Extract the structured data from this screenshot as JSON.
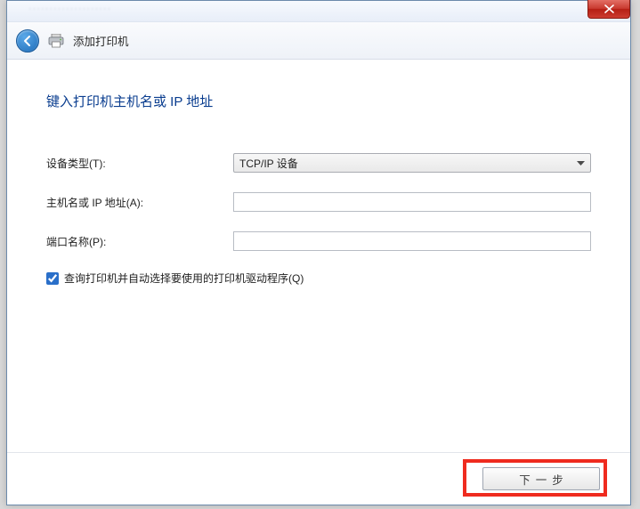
{
  "window": {
    "nav_title": "添加打印机",
    "blur_text": "····················"
  },
  "page": {
    "heading": "键入打印机主机名或 IP 地址"
  },
  "fields": {
    "device_type_label": "设备类型(T):",
    "device_type_value": "TCP/IP 设备",
    "hostname_label": "主机名或 IP 地址(A):",
    "hostname_value": "",
    "portname_label": "端口名称(P):",
    "portname_value": ""
  },
  "checkbox": {
    "label": "查询打印机并自动选择要使用的打印机驱动程序(Q)",
    "checked": true
  },
  "buttons": {
    "next": "下一步"
  }
}
